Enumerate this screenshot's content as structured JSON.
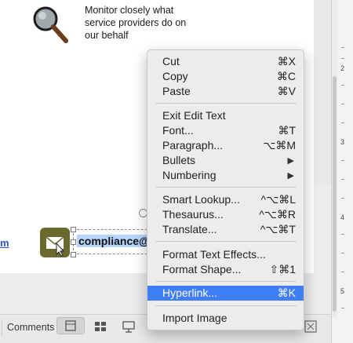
{
  "slide": {
    "monitor_text": "Monitor closely what service providers do on our behalf",
    "left_link_text": "m",
    "email_text": "compliance@"
  },
  "ruler": {
    "marks": [
      "2",
      "3",
      "4",
      "5"
    ]
  },
  "statusbar": {
    "comments_label": "Comments"
  },
  "context_menu": {
    "items": [
      {
        "label": "Cut",
        "shortcut": "⌘X"
      },
      {
        "label": "Copy",
        "shortcut": "⌘C"
      },
      {
        "label": "Paste",
        "shortcut": "⌘V"
      },
      {
        "label": "Exit Edit Text",
        "shortcut": ""
      },
      {
        "label": "Font...",
        "shortcut": "⌘T"
      },
      {
        "label": "Paragraph...",
        "shortcut": "⌥⌘M"
      },
      {
        "label": "Bullets",
        "shortcut": "▶"
      },
      {
        "label": "Numbering",
        "shortcut": "▶"
      },
      {
        "label": "Smart Lookup...",
        "shortcut": "^⌥⌘L"
      },
      {
        "label": "Thesaurus...",
        "shortcut": "^⌥⌘R"
      },
      {
        "label": "Translate...",
        "shortcut": "^⌥⌘T"
      },
      {
        "label": "Format Text Effects...",
        "shortcut": ""
      },
      {
        "label": "Format Shape...",
        "shortcut": "⇧⌘1"
      },
      {
        "label": "Hyperlink...",
        "shortcut": "⌘K"
      },
      {
        "label": "Import Image",
        "shortcut": ""
      }
    ]
  },
  "colors": {
    "menu_highlight": "#3f7ef7",
    "mail_icon_bg": "#6a6a2e",
    "selection": "#b7d5fb",
    "link": "#2a54c8"
  },
  "icons": [
    "magnifier-icon",
    "mail-icon",
    "normal-view-icon",
    "slide-sorter-icon",
    "reading-view-icon",
    "fit-slide-icon"
  ]
}
